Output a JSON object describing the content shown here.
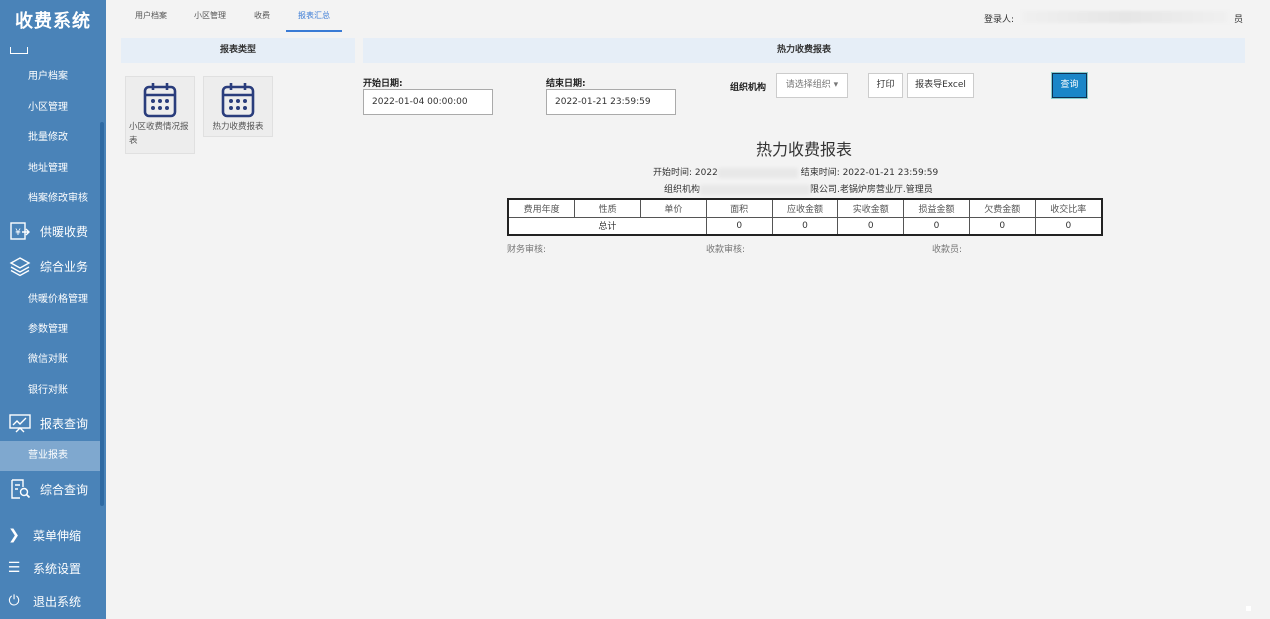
{
  "brand": "收费系统",
  "sidebar": {
    "subitems_top": [
      "用户档案",
      "小区管理",
      "批量修改",
      "地址管理",
      "档案修改审核"
    ],
    "group_heating": "供暖收费",
    "group_business": "综合业务",
    "subitems_business": [
      "供暖价格管理",
      "参数管理",
      "微信对账",
      "银行对账"
    ],
    "group_report": "报表查询",
    "subitem_report_active": "营业报表",
    "group_query": "综合查询",
    "bottom": [
      "菜单伸缩",
      "系统设置",
      "退出系统"
    ]
  },
  "tabs": [
    "用户档案",
    "小区管理",
    "收费",
    "报表汇总"
  ],
  "active_tab": "报表汇总",
  "login": {
    "label": "登录人:",
    "tail": "员"
  },
  "left_panel": {
    "title": "报表类型",
    "cards": [
      "小区收费情况报表",
      "热力收费报表"
    ]
  },
  "right_panel": {
    "title": "热力收费报表",
    "start_label": "开始日期:",
    "start_value": "2022-01-04 00:00:00",
    "end_label": "结束日期:",
    "end_value": "2022-01-21 23:59:59",
    "org_label": "组织机构",
    "org_placeholder": "请选择组织 ▾",
    "print_label": "打印",
    "excel_label": "报表导Excel",
    "query_label": "查询"
  },
  "report": {
    "title": "热力收费报表",
    "start_prefix": "开始时间: 2022",
    "end_text": "结束时间: 2022-01-21 23:59:59",
    "org_prefix": "组织机构",
    "org_suffix": "限公司.老锅炉房营业厅.管理员",
    "columns": [
      "费用年度",
      "性质",
      "单价",
      "面积",
      "应收金额",
      "实收金额",
      "损益金额",
      "欠费金额",
      "收交比率"
    ],
    "total_label": "总计",
    "totals": [
      "0",
      "0",
      "0",
      "0",
      "0",
      "0"
    ],
    "sign_finance": "财务审核:",
    "sign_receipt": "收款审核:",
    "sign_cashier": "收款员:"
  }
}
